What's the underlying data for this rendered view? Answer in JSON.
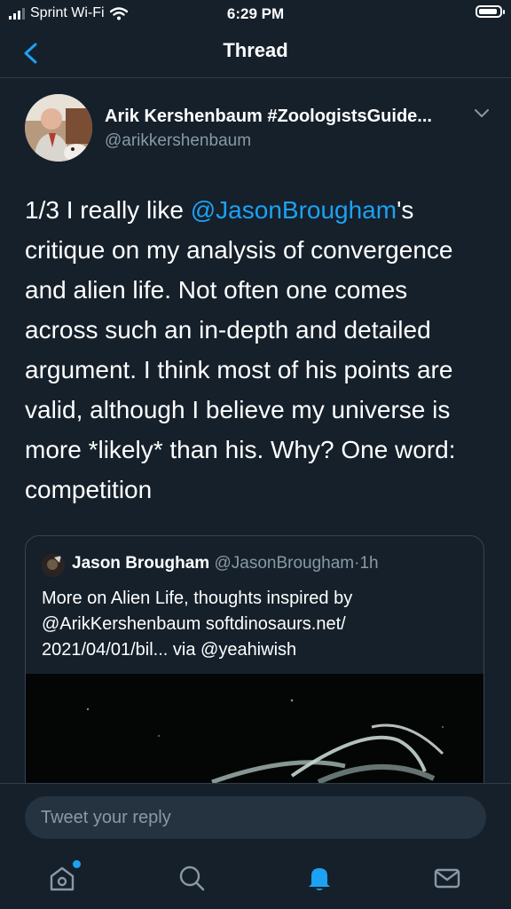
{
  "status_bar": {
    "carrier": "Sprint Wi-Fi",
    "time": "6:29 PM",
    "signal_bars_filled": 3,
    "battery_level": 0.9
  },
  "nav": {
    "title": "Thread",
    "back_icon": "chevron-left-icon"
  },
  "tweet": {
    "author_name": "Arik Kershenbaum #ZoologistsGuide...",
    "author_handle": "@arikkershenbaum",
    "text_segments": [
      {
        "text": "1/3 I really like ",
        "mention": false
      },
      {
        "text": "@JasonBrougham",
        "mention": true
      },
      {
        "text": "'s critique on my analysis of convergence and alien life. Not often one comes across such an in-depth and detailed argument. I think most of his points are valid, although I believe my universe is more *likely* than his. Why? One word: competition",
        "mention": false
      }
    ],
    "quoted": {
      "name": "Jason Brougham",
      "handle": "@JasonBrougham",
      "separator": "·",
      "time": "1h",
      "text": "More on Alien Life, thoughts inspired by @ArikKershenbaum softdinosaurs.net/ 2021/04/01/bil... via @yeahiwish"
    }
  },
  "reply": {
    "placeholder": "Tweet your reply"
  },
  "tabbar": {
    "items": [
      "home-icon",
      "search-icon",
      "notifications-icon",
      "messages-icon"
    ],
    "active": "notifications-icon"
  },
  "colors": {
    "background": "#15202b",
    "accent": "#1da1f2",
    "secondary_text": "#8899a6",
    "border": "#38444d"
  }
}
